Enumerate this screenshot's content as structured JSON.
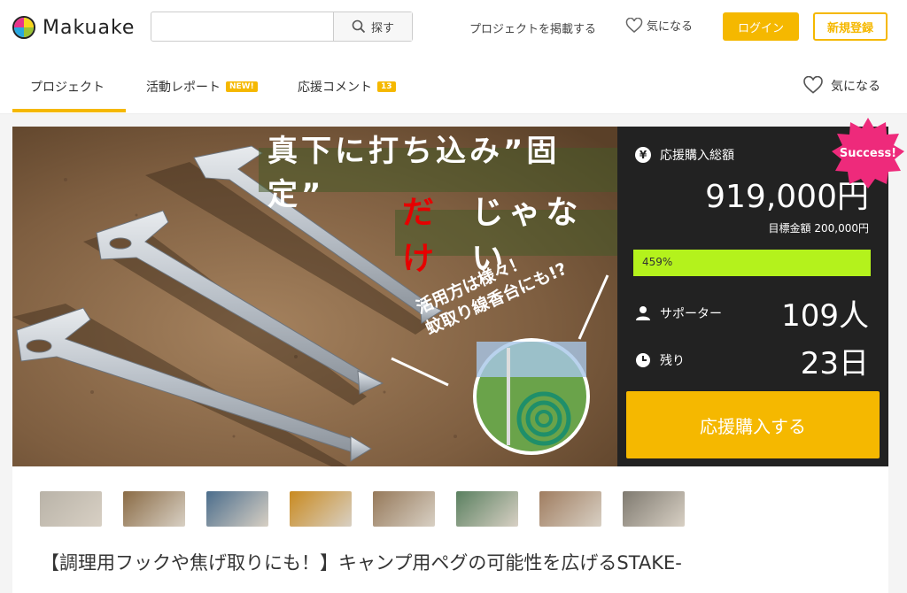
{
  "header": {
    "logo_text": "Makuake",
    "search_placeholder": "",
    "search_button": "探す",
    "post_project": "プロジェクトを掲載する",
    "favorites": "気になる",
    "login": "ログイン",
    "signup": "新規登録"
  },
  "tabs": {
    "project": "プロジェクト",
    "report": "活動レポート",
    "report_badge": "NEW!",
    "comments": "応援コメント",
    "comments_badge": "13",
    "favorite": "気になる"
  },
  "hero": {
    "title_line1": "真下に打ち込み”固定”",
    "title_line2_red": "だけ",
    "title_line2_rest": "じゃない",
    "sub_line1": "活用方は様々！",
    "sub_line2": "蚊取り線香台にも!?"
  },
  "stats": {
    "total_label": "応援購入総額",
    "total_amount": "919,000円",
    "goal": "目標金額 200,000円",
    "progress_text": "459%",
    "progress_fraction": 1.0,
    "supporters_label": "サポーター",
    "supporters_value": "109人",
    "remaining_label": "残り",
    "remaining_value": "23日",
    "buy_button": "応援購入する",
    "success_badge": "Success!"
  },
  "thumbnails": [
    {
      "name": "thumb-1",
      "color": "#b9b3a8"
    },
    {
      "name": "thumb-2",
      "color": "#8a6b45"
    },
    {
      "name": "thumb-3",
      "color": "#4b6d8c"
    },
    {
      "name": "thumb-4",
      "color": "#c98a20"
    },
    {
      "name": "thumb-5",
      "color": "#96795a"
    },
    {
      "name": "thumb-6",
      "color": "#5a8060"
    },
    {
      "name": "thumb-7",
      "color": "#a07d60"
    },
    {
      "name": "thumb-8",
      "color": "#7f7a70"
    }
  ],
  "project_title": "【調理用フックや焦げ取りにも！】キャンプ用ペグの可能性を広げるSTAKE-"
}
